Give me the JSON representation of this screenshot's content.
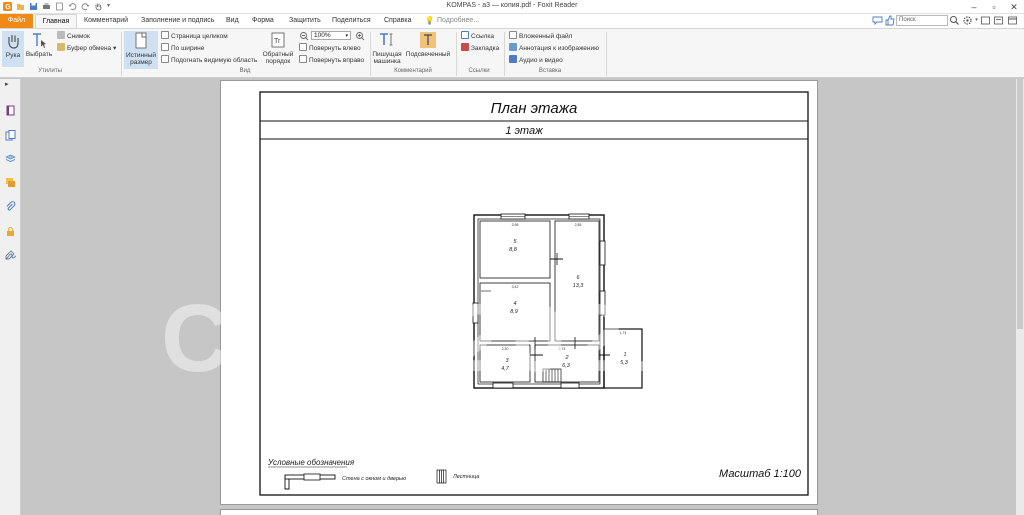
{
  "window": {
    "title": "KOMPAS - а3 — копия.pdf - Foxit Reader"
  },
  "menu": {
    "file": "Файл",
    "home": "Главная",
    "items": [
      "Комментарий",
      "Заполнение и подпись",
      "Вид",
      "Форма",
      "Защитить",
      "Поделиться",
      "Справка"
    ],
    "tell_me": "Подробнее...",
    "search_placeholder": "Поиск"
  },
  "ribbon": {
    "hand": "Рука",
    "select": "Выбрать",
    "snapshot": "Снимок",
    "clipboard": "Буфер обмена",
    "utilities": "Утилиты",
    "actual_size": [
      "Истинный",
      "размер"
    ],
    "fit_page": "Страница целиком",
    "fit_width": "По ширине",
    "fit_visible": "Подогнать видимую область",
    "reverse_order": [
      "Обратный",
      "порядок"
    ],
    "zoom": "100%",
    "rotate_left": "Повернуть влево",
    "rotate_right": "Повернуть вправо",
    "view": "Вид",
    "typewriter": [
      "Пишущая",
      "машинка"
    ],
    "highlight": "Подсвеченный",
    "comment": "Комментарий",
    "link": "Ссылка",
    "bookmark": "Закладка",
    "links": "Ссылки",
    "attach_file": "Вложенный файл",
    "image_annotation": "Аннотация к изображению",
    "audio_video": "Аудио и видео",
    "insert": "Вставка"
  },
  "document": {
    "title": "План этажа",
    "subtitle": "1 этаж",
    "legend_title": "Условные обозначения",
    "legend_wall": "Стена с окном и дверью",
    "legend_stairs": "Лестница",
    "scale": "Масштаб 1:100",
    "watermark": "CIAN 2021",
    "rooms": [
      {
        "num": "5",
        "area": "8,8"
      },
      {
        "num": "6",
        "area": "13,3"
      },
      {
        "num": "4",
        "area": "8,9"
      },
      {
        "num": "3",
        "area": "4,7"
      },
      {
        "num": "2",
        "area": "6,3"
      },
      {
        "num": "1",
        "area": "5,3"
      }
    ],
    "dims": [
      "3,98",
      "2,85",
      "3,42",
      "2,30",
      "2,74",
      "1,74"
    ]
  }
}
